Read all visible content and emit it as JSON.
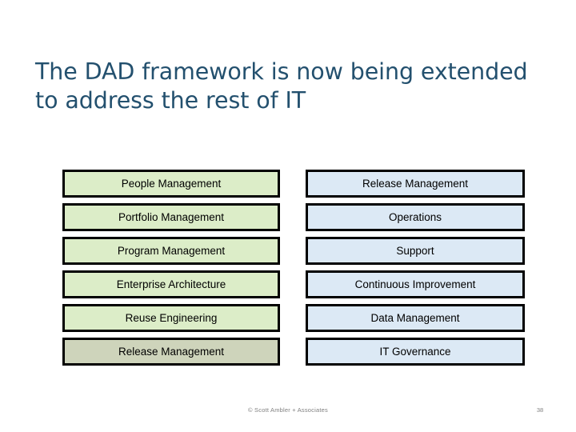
{
  "slide": {
    "title": "The DAD framework is now being extended to address the rest of IT",
    "colors": {
      "title_text": "#23506E",
      "box_border": "#000000",
      "box_fill_green": "#DCEDC8",
      "box_fill_green_muted": "#CED4BB",
      "box_fill_blue": "#DCE9F5",
      "box_text": "#000000",
      "footer_text": "#808080"
    },
    "columns": [
      {
        "name": "left-column",
        "boxes": [
          {
            "label": "People Management",
            "fill": "#DCEDC8"
          },
          {
            "label": "Portfolio Management",
            "fill": "#DCEDC8"
          },
          {
            "label": "Program Management",
            "fill": "#DCEDC8"
          },
          {
            "label": "Enterprise Architecture",
            "fill": "#DCEDC8"
          },
          {
            "label": "Reuse Engineering",
            "fill": "#DCEDC8"
          },
          {
            "label": "Release Management",
            "fill": "#CED4BB"
          }
        ]
      },
      {
        "name": "right-column",
        "boxes": [
          {
            "label": "Release Management",
            "fill": "#DCE9F5"
          },
          {
            "label": "Operations",
            "fill": "#DCE9F5"
          },
          {
            "label": "Support",
            "fill": "#DCE9F5"
          },
          {
            "label": "Continuous Improvement",
            "fill": "#DCE9F5"
          },
          {
            "label": "Data Management",
            "fill": "#DCE9F5"
          },
          {
            "label": "IT Governance",
            "fill": "#DCE9F5"
          }
        ]
      }
    ],
    "footer": {
      "copyright": "© Scott Ambler + Associates",
      "page_number": "38"
    }
  }
}
